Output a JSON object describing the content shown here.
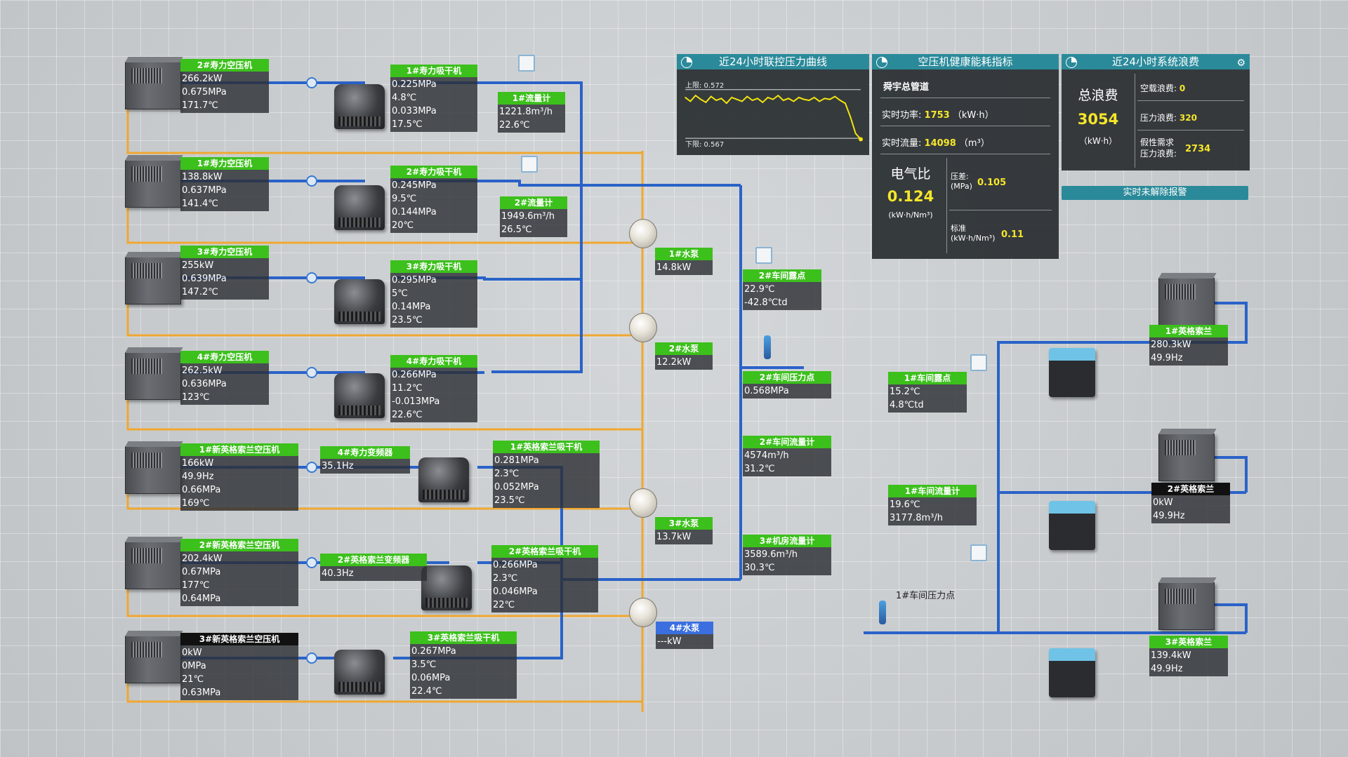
{
  "compressors_left": [
    {
      "name": "2#寿力空压机",
      "lines": [
        "266.2kW",
        "0.675MPa",
        "171.7℃"
      ]
    },
    {
      "name": "1#寿力空压机",
      "lines": [
        "138.8kW",
        "0.637MPa",
        "141.4℃"
      ]
    },
    {
      "name": "3#寿力空压机",
      "lines": [
        "255kW",
        "0.639MPa",
        "147.2℃"
      ]
    },
    {
      "name": "4#寿力空压机",
      "lines": [
        "262.5kW",
        "0.636MPa",
        "123℃"
      ]
    },
    {
      "name": "1#新英格索兰空压机",
      "lines": [
        "166kW",
        "49.9Hz",
        "0.66MPa",
        "169℃"
      ]
    },
    {
      "name": "2#新英格索兰空压机",
      "lines": [
        "202.4kW",
        "0.67MPa",
        "177℃",
        "0.64MPa"
      ]
    },
    {
      "name": "3#新英格索兰空压机",
      "lines": [
        "0kW",
        "0MPa",
        "21℃",
        "0.63MPa"
      ]
    }
  ],
  "dryers": [
    {
      "name": "1#寿力吸干机",
      "lines": [
        "0.225MPa",
        "4.8℃",
        "0.033MPa",
        "17.5℃"
      ]
    },
    {
      "name": "2#寿力吸干机",
      "lines": [
        "0.245MPa",
        "9.5℃",
        "0.144MPa",
        "20℃"
      ]
    },
    {
      "name": "3#寿力吸干机",
      "lines": [
        "0.295MPa",
        "5℃",
        "0.14MPa",
        "23.5℃"
      ]
    },
    {
      "name": "4#寿力吸干机",
      "lines": [
        "0.266MPa",
        "11.2℃",
        "-0.013MPa",
        "22.6℃"
      ]
    },
    {
      "name": "1#英格索兰吸干机",
      "lines": [
        "0.281MPa",
        "2.3℃",
        "0.052MPa",
        "23.5℃"
      ]
    },
    {
      "name": "2#英格索兰吸干机",
      "lines": [
        "0.266MPa",
        "2.3℃",
        "0.046MPa",
        "22℃"
      ]
    },
    {
      "name": "3#英格索兰吸干机",
      "lines": [
        "0.267MPa",
        "3.5℃",
        "0.06MPa",
        "22.4℃"
      ]
    }
  ],
  "flowmeters": [
    {
      "name": "1#流量计",
      "lines": [
        "1221.8m³/h",
        "22.6℃"
      ]
    },
    {
      "name": "2#流量计",
      "lines": [
        "1949.6m³/h",
        "26.5℃"
      ]
    }
  ],
  "inverters": [
    {
      "name": "4#寿力变频器",
      "lines": [
        "35.1Hz"
      ]
    },
    {
      "name": "2#英格索兰变频器",
      "lines": [
        "40.3Hz"
      ]
    }
  ],
  "pumps": [
    {
      "name": "1#水泵",
      "lines": [
        "14.8kW"
      ]
    },
    {
      "name": "2#水泵",
      "lines": [
        "12.2kW"
      ]
    },
    {
      "name": "3#水泵",
      "lines": [
        "13.7kW"
      ]
    },
    {
      "name": "4#水泵",
      "lines": [
        "---kW"
      ]
    }
  ],
  "workshop_points": [
    {
      "name": "2#车间露点",
      "lines": [
        "22.9℃",
        "-42.8℃td"
      ]
    },
    {
      "name": "2#车间压力点",
      "lines": [
        "0.568MPa"
      ]
    },
    {
      "name": "2#车间流量计",
      "lines": [
        "4574m³/h",
        "31.2℃"
      ]
    },
    {
      "name": "3#机房流量计",
      "lines": [
        "3589.6m³/h",
        "30.3℃"
      ]
    },
    {
      "name": "1#车间露点",
      "lines": [
        "15.2℃",
        "4.8℃td"
      ]
    },
    {
      "name": "1#车间流量计",
      "lines": [
        "19.6℃",
        "3177.8m³/h"
      ]
    }
  ],
  "workshop1_pressure_label": "1#车间压力点",
  "right_units": [
    {
      "name": "1#英格索兰",
      "lines": [
        "280.3kW",
        "49.9Hz"
      ]
    },
    {
      "name": "2#英格索兰",
      "lines": [
        "0kW",
        "49.9Hz"
      ]
    },
    {
      "name": "3#英格索兰",
      "lines": [
        "139.4kW",
        "49.9Hz"
      ]
    }
  ],
  "panel_pressure": {
    "title": "近24小时联控压力曲线",
    "upper_label": "上限: 0.572",
    "lower_label": "下限: 0.567"
  },
  "panel_health": {
    "title": "空压机健康能耗指标",
    "pipe": "舜宇总管道",
    "power_label": "实时功率:",
    "power_value": "1753",
    "power_unit": "（kW·h）",
    "flow_label": "实时流量:",
    "flow_value": "14098",
    "flow_unit": "（m³）",
    "ratio_label": "电气比",
    "ratio_value": "0.124",
    "ratio_unit": "(kW·h/Nm³)",
    "dp_label": "压差:",
    "dp_unit": "(MPa)",
    "dp_value": "0.105",
    "std_label": "标准",
    "std_unit": "(kW·h/Nm³)",
    "std_value": "0.11"
  },
  "panel_waste": {
    "title": "近24小时系统浪费",
    "total_label": "总浪费",
    "total_value": "3054",
    "total_unit": "（kW·h）",
    "idle_label": "空载浪费:",
    "idle_value": "0",
    "press_label": "压力浪费:",
    "press_value": "320",
    "fake_label1": "假性需求",
    "fake_label2": "压力浪费:",
    "fake_value": "2734"
  },
  "alarm_label": "实时未解除报警",
  "chart_data": {
    "type": "line",
    "title": "近24小时联控压力曲线",
    "upper_limit": 0.572,
    "lower_limit": 0.567,
    "series": [
      {
        "values": [
          0.5712,
          0.5708,
          0.5714,
          0.571,
          0.5707,
          0.5713,
          0.5709,
          0.5711,
          0.5706,
          0.5712,
          0.571,
          0.5708,
          0.5713,
          0.5709,
          0.5711,
          0.5707,
          0.5712,
          0.571,
          0.5714,
          0.5709,
          0.5711,
          0.5708,
          0.5712,
          0.571,
          0.5709,
          0.5712,
          0.5708,
          0.5711,
          0.571,
          0.5713,
          0.5709,
          0.5706,
          0.5692,
          0.5675,
          0.5669
        ]
      }
    ],
    "ylim": [
      0.566,
      0.5735
    ],
    "colors": {
      "line": "#f2e40e",
      "limit": "#d8dde2"
    }
  },
  "colors": {
    "orange_pipe": "#f0a830",
    "blue_pipe": "#2a62c8",
    "green_header": "#3cc01c",
    "panel_header": "#2b8a9a",
    "value_yellow": "#f5e62a"
  }
}
